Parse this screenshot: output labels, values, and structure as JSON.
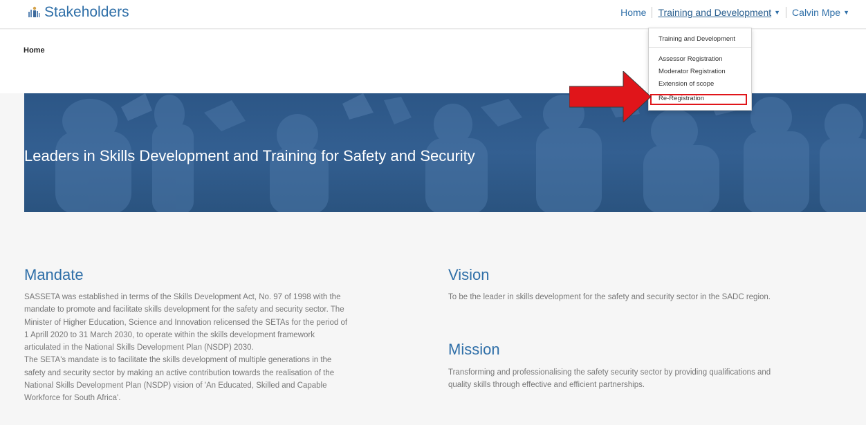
{
  "navbar": {
    "brand": "Stakeholders",
    "links": {
      "home": "Home",
      "training": "Training and Development",
      "user": "Calvin Mpe"
    }
  },
  "breadcrumb": "Home",
  "dropdown": {
    "header": "Training and Development",
    "items": [
      "Assessor Registration",
      "Moderator Registration",
      "Extension of scope",
      "Re-Registration"
    ],
    "highlighted": "Re-Registration"
  },
  "annotation": {
    "color": "#e0151a"
  },
  "hero": {
    "title": "Leaders in Skills Development and Training for Safety and Security"
  },
  "mandate": {
    "title": "Mandate",
    "lines": [
      "SASSETA was established in terms of the Skills Development Act, No. 97 of 1998 with the",
      "mandate to promote and facilitate skills development for the safety and security sector. The",
      "Minister of Higher Education, Science and Innovation relicensed the SETAs for the period of",
      "1 Aprill 2020 to 31 March 2030, to operate within the skills development framework",
      "articulated in the National Skills Development Plan (NSDP) 2030.",
      "The SETA's mandate is to facilitate the skills development of multiple generations in the",
      "safety and security sector by making an active contribution towards the realisation of the",
      "National Skills Development  Plan (NSDP) vision of 'An Educated, Skilled and Capable",
      "Workforce for South Africa'."
    ]
  },
  "vision": {
    "title": "Vision",
    "text": "To be the leader in skills development for the safety and security sector in the SADC region."
  },
  "mission": {
    "title": "Mission",
    "lines": [
      "Transforming and professionalising the safety security sector by providing qualifications and",
      "quality skills through effective and efficient partnerships."
    ]
  },
  "colors": {
    "accent": "#2f6fa8",
    "hero": "#2c5686",
    "highlight": "#e0151a"
  }
}
